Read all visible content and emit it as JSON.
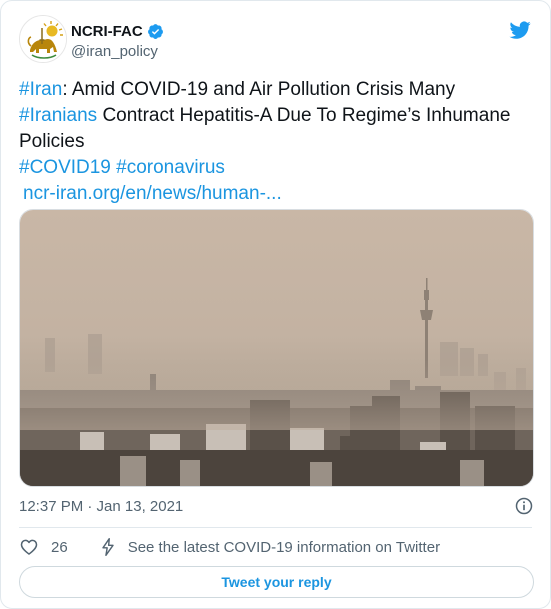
{
  "account": {
    "display_name": "NCRI-FAC",
    "handle": "@iran_policy",
    "avatar_icon": "lion-and-sun-emblem-icon",
    "verified_icon": "verified-badge-icon",
    "brand_icon": "twitter-bird-icon"
  },
  "tweet": {
    "hashtag_iran": "#Iran",
    "text_part1": ": Amid COVID-19 and Air Pollution Crisis Many",
    "hashtag_iranians": "#Iranians",
    "text_part2": " Contract Hepatitis-A Due To Regime’s Inhumane Policies",
    "hashtag_covid19": "#COVID19",
    "hashtag_coronavirus": "#coronavirus",
    "url_text": "ncr-iran.org/en/news/human-..."
  },
  "media": {
    "kind": "photo",
    "subject": "smog-city-skyline-with-tower"
  },
  "meta": {
    "timestamp": "12:37 PM · Jan 13, 2021",
    "info_icon": "info-icon"
  },
  "actions": {
    "like_icon": "heart-icon",
    "like_count": "26",
    "covid_icon": "lightning-bolt-icon",
    "covid_text": "See the latest COVID-19 information on Twitter"
  },
  "reply": {
    "label": "Tweet your reply"
  },
  "colors": {
    "link": "#1b95e0",
    "text": "#0f1419",
    "muted": "#536471",
    "border": "#e1e8ed",
    "verified": "#1d9bf0"
  }
}
